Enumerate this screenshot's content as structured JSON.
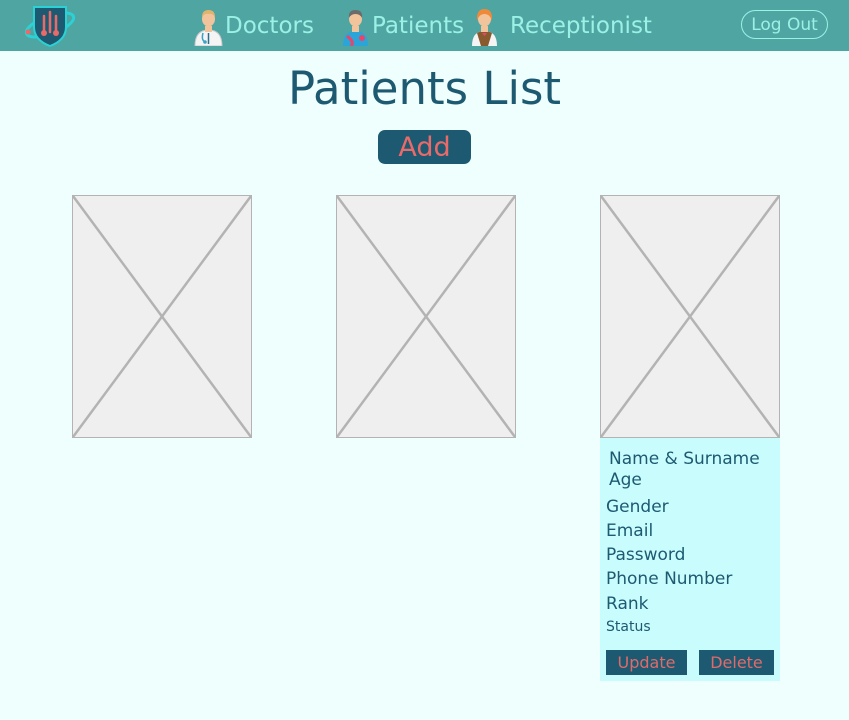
{
  "nav": {
    "doctors_label": "Doctors",
    "patients_label": "Patients",
    "receptionist_label": "Receptionist",
    "logout_label": "Log Out"
  },
  "page": {
    "title": "Patients List",
    "add_label": "Add"
  },
  "details": {
    "fields": [
      "Name & Surname",
      "Age",
      "Gender",
      "Email",
      "Password",
      "Phone Number",
      "Rank",
      "Status"
    ],
    "update_label": "Update",
    "delete_label": "Delete"
  },
  "colors": {
    "topbar": "#4fa5a2",
    "nav_text": "#9cf0e6",
    "primary": "#1d5a72",
    "accent_text": "#ea6a6a",
    "background": "#effffd",
    "details_bg": "#c9fcfc"
  },
  "icons": [
    "hospital-logo-icon",
    "doctor-icon",
    "patient-icon",
    "receptionist-icon",
    "image-placeholder-icon"
  ]
}
